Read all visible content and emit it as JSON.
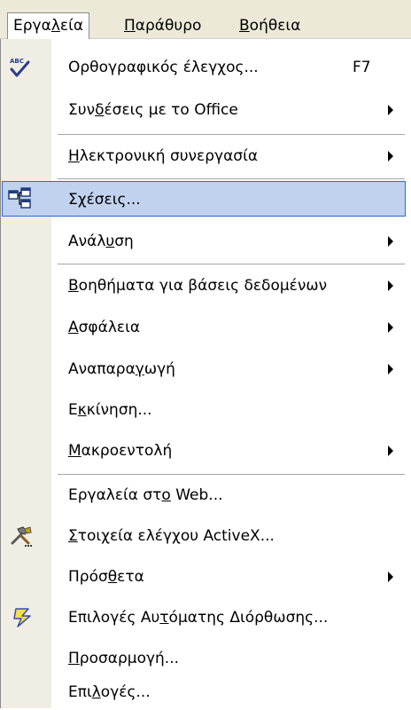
{
  "menubar": {
    "items": [
      {
        "label_parts": [
          "Εργα",
          "λ",
          "εία"
        ]
      },
      {
        "label_parts": [
          "",
          "Π",
          "αράθυρο"
        ]
      },
      {
        "label_parts": [
          "",
          "Β",
          "οήθεια"
        ]
      }
    ]
  },
  "menu": {
    "items": [
      {
        "label_parts": [
          "Ορθογραφικός έλεγχος...",
          "",
          ""
        ],
        "shortcut": "F7",
        "icon": "spelling-check-icon"
      },
      {
        "label_parts": [
          "Συν",
          "δ",
          "έσεις με το Office"
        ]
      },
      {
        "label_parts": [
          "",
          "Η",
          "λεκτρονική συνεργασία"
        ]
      },
      {
        "label_parts": [
          "Σ",
          "χ",
          "έσεις..."
        ],
        "icon": "relationships-icon"
      },
      {
        "label_parts": [
          "Ανάλ",
          "υ",
          "ση"
        ]
      },
      {
        "label_parts": [
          "",
          "Β",
          "οηθήματα για βάσεις δεδομένων"
        ]
      },
      {
        "label_parts": [
          "",
          "Α",
          "σφάλεια"
        ]
      },
      {
        "label_parts": [
          "Αναπαρα",
          "γ",
          "ωγή"
        ]
      },
      {
        "label_parts": [
          "Ε",
          "κ",
          "κίνηση..."
        ]
      },
      {
        "label_parts": [
          "",
          "Μ",
          "ακροεντολή"
        ]
      },
      {
        "label_parts": [
          "Εργαλεία στ",
          "ο",
          " Web..."
        ]
      },
      {
        "label_parts": [
          "",
          "Σ",
          "τοιχεία ελέγχου ActiveX..."
        ],
        "icon": "activex-controls-icon"
      },
      {
        "label_parts": [
          "Πρόσ",
          "θ",
          "ετα"
        ]
      },
      {
        "label_parts": [
          "Επιλογές Αυ",
          "τ",
          "όματης Διόρθωσης..."
        ],
        "icon": "autocorrect-icon"
      },
      {
        "label_parts": [
          "",
          "Π",
          "ροσαρμογή..."
        ]
      },
      {
        "label_parts": [
          "Επι",
          "λ",
          "ογές..."
        ]
      }
    ]
  }
}
